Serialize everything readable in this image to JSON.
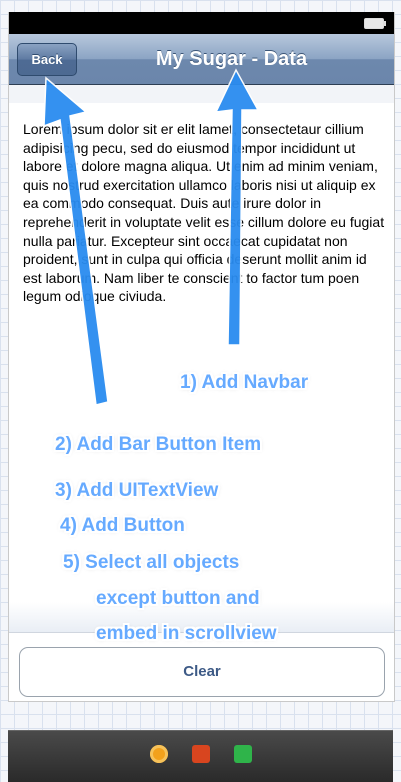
{
  "navbar": {
    "back_label": "Back",
    "title": "My Sugar - Data"
  },
  "text_view": {
    "content": "Lorem ipsum dolor sit er elit lamet, consectetaur cillium adipisicing pecu, sed do eiusmod tempor incididunt ut labore et dolore magna aliqua. Ut enim ad minim veniam, quis nostrud exercitation ullamco laboris nisi ut aliquip ex ea commodo consequat. Duis aute irure dolor in reprehenderit in voluptate velit esse cillum dolore eu fugiat nulla pariatur. Excepteur sint occaecat cupidatat non proident, sunt in culpa qui officia deserunt mollit anim id est laborum. Nam liber te conscient to factor tum poen legum odioque civiuda."
  },
  "button": {
    "clear_label": "Clear"
  },
  "annotations": {
    "step1": "1) Add Navbar",
    "step2": "2) Add Bar Button Item",
    "step3": "3) Add UITextView",
    "step4": "4) Add Button",
    "step5_line1": "5) Select all objects",
    "step5_line2": "except button and",
    "step5_line3": "embed in scrollview"
  },
  "toolbar_icons": [
    "cube-icon",
    "box-icon",
    "exit-icon"
  ],
  "colors": {
    "annotation": "#66aaff",
    "arrow": "#2a8cf0",
    "clear_text": "#3d5a86"
  }
}
